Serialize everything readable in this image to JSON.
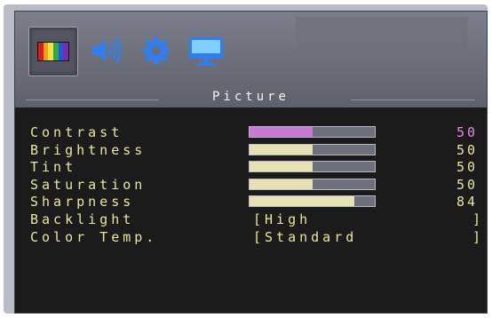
{
  "menu": {
    "tabs": [
      {
        "name": "picture",
        "icon": "rainbow-bars-icon",
        "selected": true
      },
      {
        "name": "audio",
        "icon": "speaker-icon",
        "selected": false
      },
      {
        "name": "setup",
        "icon": "gear-icon",
        "selected": false
      },
      {
        "name": "display",
        "icon": "monitor-icon",
        "selected": false
      }
    ],
    "title": "Picture"
  },
  "settings": [
    {
      "label": "Contrast",
      "value": "50",
      "level": 0.5,
      "fill_color": "#c779d2",
      "value_color": "#e08ae0"
    },
    {
      "label": "Brightness",
      "value": "50",
      "level": 0.5,
      "fill_color": "#e6e2b4",
      "value_color": "#e7e89c"
    },
    {
      "label": "Tint",
      "value": "50",
      "level": 0.5,
      "fill_color": "#e6e2b4",
      "value_color": "#e7e89c"
    },
    {
      "label": "Saturation",
      "value": "50",
      "level": 0.5,
      "fill_color": "#e6e2b4",
      "value_color": "#e7e89c"
    },
    {
      "label": "Sharpness",
      "value": "84",
      "level": 0.84,
      "fill_color": "#e6e2b4",
      "value_color": "#e7e89c"
    }
  ],
  "options": [
    {
      "label": "Backlight",
      "open": "[",
      "value": "High",
      "close": "]"
    },
    {
      "label": "Color Temp.",
      "open": "[",
      "value": "Standard",
      "close": "]"
    }
  ],
  "colors": {
    "text": "#e7e89c",
    "background": "#1b1b1b",
    "bar_track": "#6d6f7b",
    "accent": "#c779d2",
    "icon_blue": "#2f7ff0"
  }
}
